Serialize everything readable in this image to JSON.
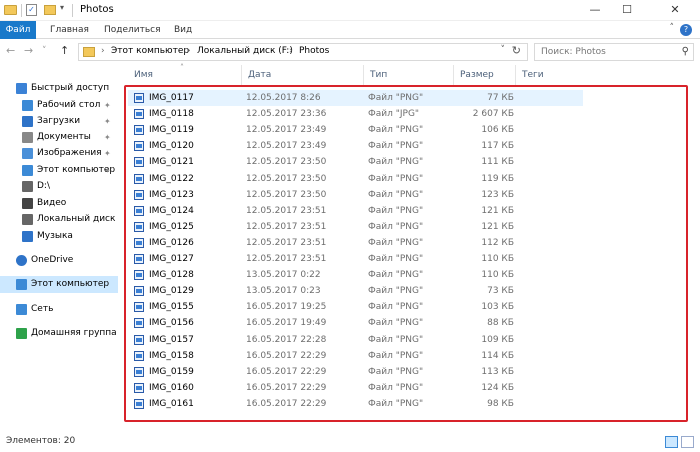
{
  "window": {
    "title": "Photos",
    "minimize_glyph": "—",
    "maximize_glyph": "☐",
    "close_glyph": "✕"
  },
  "ribbon": {
    "tabs": [
      "Файл",
      "Главная",
      "Поделиться",
      "Вид"
    ],
    "collapse_glyph": "˄",
    "help_glyph": "?"
  },
  "nav": {
    "back_glyph": "←",
    "forward_glyph": "→",
    "recent_glyph": "˅",
    "up_glyph": "↑",
    "breadcrumb": [
      "Этот компьютер",
      "Локальный диск (F:)",
      "Photos"
    ],
    "crumb_sep": "›",
    "dropdown_glyph": "˅",
    "refresh_glyph": "↻",
    "search_placeholder": "Поиск: Photos",
    "search_glyph": "⚲"
  },
  "sidebar": {
    "items": [
      {
        "label": "Быстрый доступ",
        "icon": "star-icon",
        "color": "#3b82d6",
        "pinned": false
      },
      {
        "label": "Рабочий стол",
        "icon": "desktop-icon",
        "color": "#3c8ad6",
        "pinned": true
      },
      {
        "label": "Загрузки",
        "icon": "download-icon",
        "color": "#2e73c8",
        "pinned": true
      },
      {
        "label": "Документы",
        "icon": "document-icon",
        "color": "#888888",
        "pinned": true
      },
      {
        "label": "Изображения",
        "icon": "pictures-icon",
        "color": "#4a90d9",
        "pinned": true
      },
      {
        "label": "Этот компьютер",
        "icon": "computer-icon",
        "color": "#3c8ad6",
        "pinned": true
      },
      {
        "label": "D:\\",
        "icon": "drive-icon",
        "color": "#666666",
        "pinned": false
      },
      {
        "label": "Видео",
        "icon": "video-icon",
        "color": "#444444",
        "pinned": false
      },
      {
        "label": "Локальный диск (F",
        "icon": "drive-icon",
        "color": "#666666",
        "pinned": false
      },
      {
        "label": "Музыка",
        "icon": "music-icon",
        "color": "#2e73c8",
        "pinned": false
      },
      {
        "label": "OneDrive",
        "icon": "cloud-icon",
        "color": "#2e73c8",
        "pinned": false
      },
      {
        "label": "Этот компьютер",
        "icon": "computer-icon",
        "color": "#3c8ad6",
        "pinned": false,
        "selected": true
      },
      {
        "label": "Сеть",
        "icon": "network-icon",
        "color": "#3c8ad6",
        "pinned": false
      },
      {
        "label": "Домашняя группа",
        "icon": "homegroup-icon",
        "color": "#2ea24a",
        "pinned": false
      }
    ],
    "pin_glyph": "✦"
  },
  "columns": {
    "name": "Имя",
    "date": "Дата",
    "type": "Тип",
    "size": "Размер",
    "tags": "Теги",
    "sort_glyph": "˄"
  },
  "files": [
    {
      "name": "IMG_0117",
      "date": "12.05.2017 8:26",
      "type": "Файл \"PNG\"",
      "size": "77 КБ"
    },
    {
      "name": "IMG_0118",
      "date": "12.05.2017 23:36",
      "type": "Файл \"JPG\"",
      "size": "2 607 КБ"
    },
    {
      "name": "IMG_0119",
      "date": "12.05.2017 23:49",
      "type": "Файл \"PNG\"",
      "size": "106 КБ"
    },
    {
      "name": "IMG_0120",
      "date": "12.05.2017 23:49",
      "type": "Файл \"PNG\"",
      "size": "117 КБ"
    },
    {
      "name": "IMG_0121",
      "date": "12.05.2017 23:50",
      "type": "Файл \"PNG\"",
      "size": "111 КБ"
    },
    {
      "name": "IMG_0122",
      "date": "12.05.2017 23:50",
      "type": "Файл \"PNG\"",
      "size": "119 КБ"
    },
    {
      "name": "IMG_0123",
      "date": "12.05.2017 23:50",
      "type": "Файл \"PNG\"",
      "size": "123 КБ"
    },
    {
      "name": "IMG_0124",
      "date": "12.05.2017 23:51",
      "type": "Файл \"PNG\"",
      "size": "121 КБ"
    },
    {
      "name": "IMG_0125",
      "date": "12.05.2017 23:51",
      "type": "Файл \"PNG\"",
      "size": "121 КБ"
    },
    {
      "name": "IMG_0126",
      "date": "12.05.2017 23:51",
      "type": "Файл \"PNG\"",
      "size": "112 КБ"
    },
    {
      "name": "IMG_0127",
      "date": "12.05.2017 23:51",
      "type": "Файл \"PNG\"",
      "size": "110 КБ"
    },
    {
      "name": "IMG_0128",
      "date": "13.05.2017 0:22",
      "type": "Файл \"PNG\"",
      "size": "110 КБ"
    },
    {
      "name": "IMG_0129",
      "date": "13.05.2017 0:23",
      "type": "Файл \"PNG\"",
      "size": "73 КБ"
    },
    {
      "name": "IMG_0155",
      "date": "16.05.2017 19:25",
      "type": "Файл \"PNG\"",
      "size": "103 КБ"
    },
    {
      "name": "IMG_0156",
      "date": "16.05.2017 19:49",
      "type": "Файл \"PNG\"",
      "size": "88 КБ"
    },
    {
      "name": "IMG_0157",
      "date": "16.05.2017 22:28",
      "type": "Файл \"PNG\"",
      "size": "109 КБ"
    },
    {
      "name": "IMG_0158",
      "date": "16.05.2017 22:29",
      "type": "Файл \"PNG\"",
      "size": "114 КБ"
    },
    {
      "name": "IMG_0159",
      "date": "16.05.2017 22:29",
      "type": "Файл \"PNG\"",
      "size": "113 КБ"
    },
    {
      "name": "IMG_0160",
      "date": "16.05.2017 22:29",
      "type": "Файл \"PNG\"",
      "size": "124 КБ"
    },
    {
      "name": "IMG_0161",
      "date": "16.05.2017 22:29",
      "type": "Файл \"PNG\"",
      "size": "98 КБ"
    }
  ],
  "status": {
    "count_text": "Элементов: 20"
  },
  "colors": {
    "accent": "#1979ca",
    "highlight_box": "#d8232a",
    "selection": "#cce8ff"
  }
}
